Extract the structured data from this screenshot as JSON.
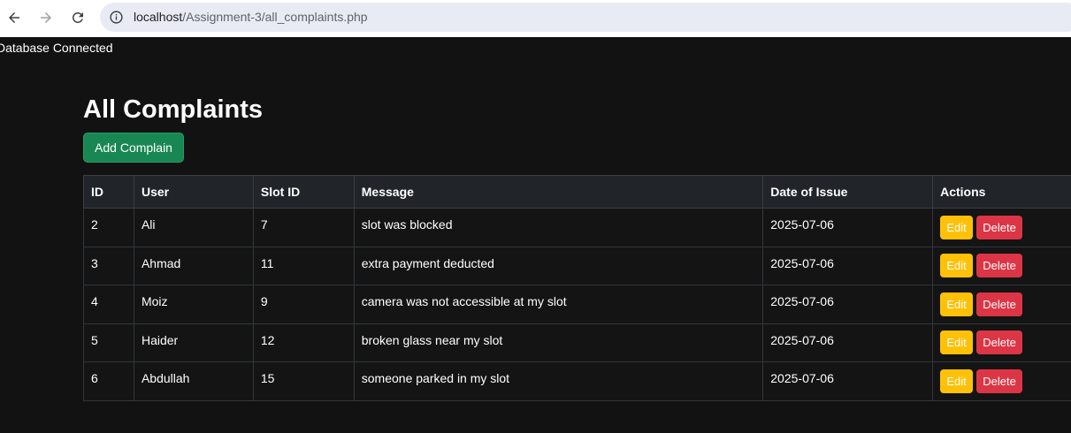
{
  "browser": {
    "url_host": "localhost",
    "url_path": "/Assignment-3/all_complaints.php"
  },
  "status_text": "Database Connected",
  "page_title": "All Complaints",
  "add_button_label": "Add Complain",
  "table": {
    "headers": [
      "ID",
      "User",
      "Slot ID",
      "Message",
      "Date of Issue",
      "Actions"
    ],
    "rows": [
      {
        "id": "2",
        "user": "Ali",
        "slot_id": "7",
        "message": "slot was blocked",
        "date": "2025-07-06"
      },
      {
        "id": "3",
        "user": "Ahmad",
        "slot_id": "11",
        "message": "extra payment deducted",
        "date": "2025-07-06"
      },
      {
        "id": "4",
        "user": "Moiz",
        "slot_id": "9",
        "message": "camera was not accessible at my slot",
        "date": "2025-07-06"
      },
      {
        "id": "5",
        "user": "Haider",
        "slot_id": "12",
        "message": "broken glass near my slot",
        "date": "2025-07-06"
      },
      {
        "id": "6",
        "user": "Abdullah",
        "slot_id": "15",
        "message": "someone parked in my slot",
        "date": "2025-07-06"
      }
    ],
    "edit_label": "Edit",
    "delete_label": "Delete"
  },
  "icons": [
    "back-arrow-icon",
    "forward-arrow-icon",
    "reload-icon",
    "site-info-icon"
  ],
  "colors": {
    "page_bg": "#121212",
    "header_bg": "#212529",
    "add_button": "#198754",
    "edit_button": "#ffc107",
    "delete_button": "#dc3545"
  }
}
